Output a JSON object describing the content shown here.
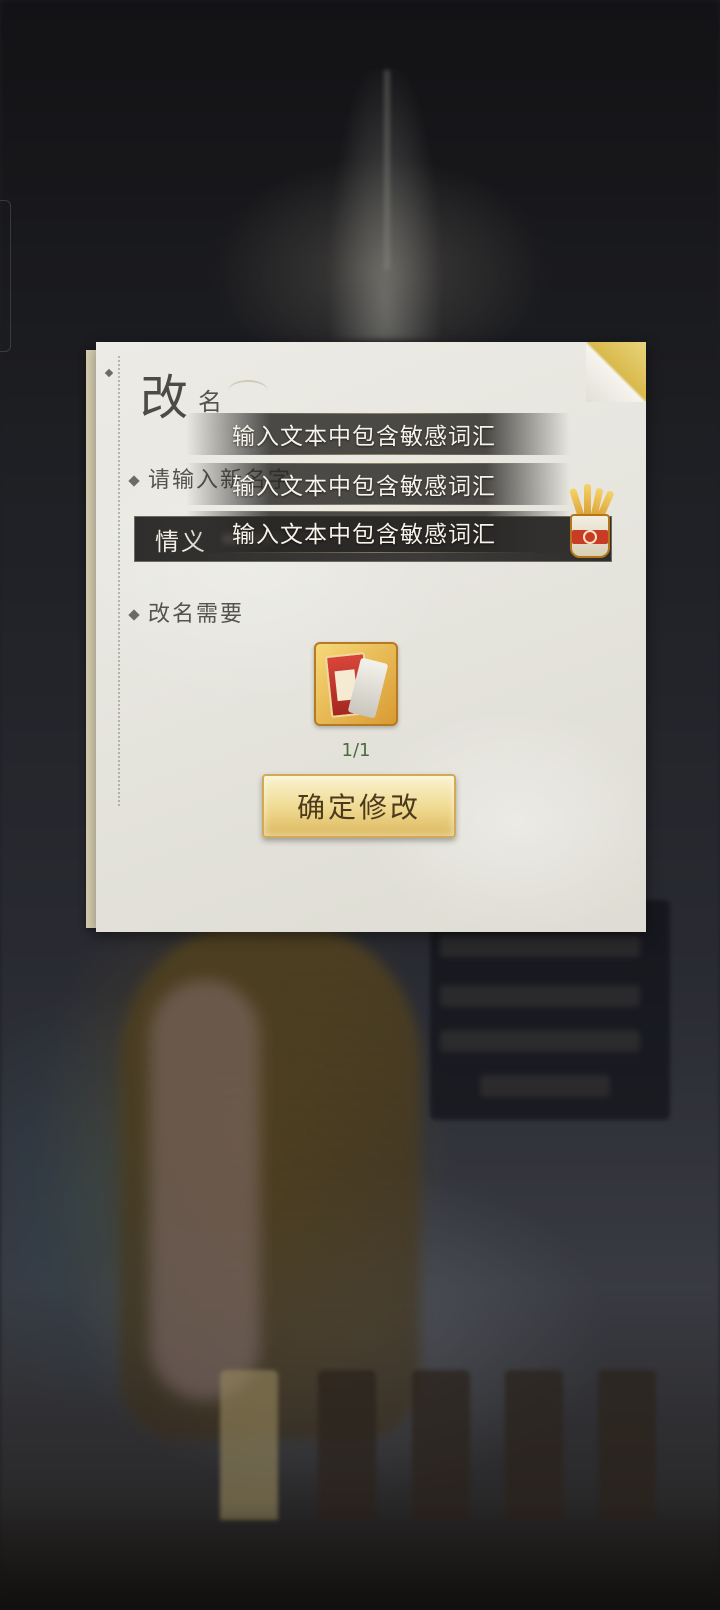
{
  "dialog": {
    "title_big": "改",
    "title_small": "名",
    "prompt_label": "请输入新名字",
    "current_name": "情义",
    "requirement_label": "改名需要",
    "item_count": "1/1",
    "confirm_label": "确定修改"
  },
  "toasts": [
    "输入文本中包含敏感词汇",
    "输入文本中包含敏感词汇",
    "输入文本中包含敏感词汇"
  ],
  "colors": {
    "paper": "#e6e5de",
    "field_bg": "#3c3b39",
    "button_gold": "#efd98f",
    "accent_red": "#c83c26",
    "count_green": "#4e6b3e"
  },
  "icons": {
    "random_name": "fortune-sticks-cup-icon",
    "item": "rename-card-icon"
  }
}
